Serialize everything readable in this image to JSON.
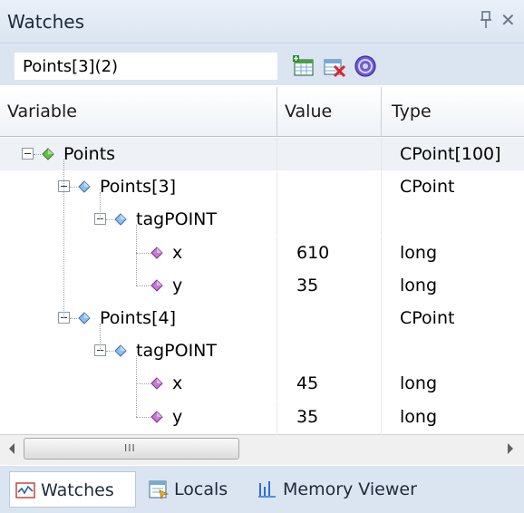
{
  "window": {
    "title": "Watches"
  },
  "toolbar": {
    "expression": "Points[3](2)"
  },
  "columns": {
    "variable": "Variable",
    "value": "Value",
    "type": "Type"
  },
  "rows": [
    {
      "name": "Points",
      "value": "",
      "type": "CPoint[100]",
      "level": 0,
      "expander": true,
      "gem": "green"
    },
    {
      "name": "Points[3]",
      "value": "",
      "type": "CPoint",
      "level": 1,
      "expander": true,
      "gem": "blue"
    },
    {
      "name": "tagPOINT",
      "value": "",
      "type": "",
      "level": 2,
      "expander": true,
      "gem": "blue"
    },
    {
      "name": "x",
      "value": "610",
      "type": "long",
      "level": 3,
      "expander": false,
      "gem": "purple"
    },
    {
      "name": "y",
      "value": "35",
      "type": "long",
      "level": 3,
      "expander": false,
      "gem": "purple"
    },
    {
      "name": "Points[4]",
      "value": "",
      "type": "CPoint",
      "level": 1,
      "expander": true,
      "gem": "blue"
    },
    {
      "name": "tagPOINT",
      "value": "",
      "type": "",
      "level": 2,
      "expander": true,
      "gem": "blue"
    },
    {
      "name": "x",
      "value": "45",
      "type": "long",
      "level": 3,
      "expander": false,
      "gem": "purple"
    },
    {
      "name": "y",
      "value": "35",
      "type": "long",
      "level": 3,
      "expander": false,
      "gem": "purple"
    }
  ],
  "scrollbar": {
    "grip": "III"
  },
  "tabs": [
    {
      "label": "Watches",
      "icon": "watch-icon",
      "active": true
    },
    {
      "label": "Locals",
      "icon": "locals-icon",
      "active": false
    },
    {
      "label": "Memory Viewer",
      "icon": "memory-viewer-icon",
      "active": false
    }
  ],
  "colors": {
    "panel": "#dbe5f1",
    "accent": "#2a5ea8"
  }
}
